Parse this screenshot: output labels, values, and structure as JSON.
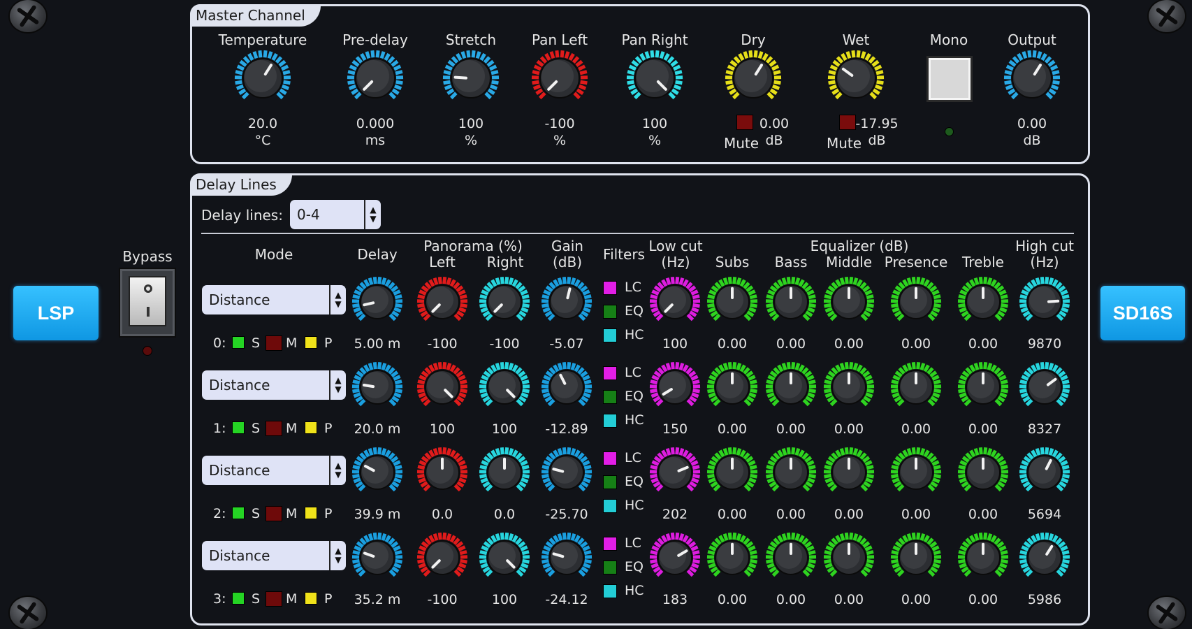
{
  "brand_left": "LSP",
  "brand_right": "SD16S",
  "bypass": {
    "label": "Bypass"
  },
  "master": {
    "title": "Master Channel",
    "knobs": [
      {
        "label": "Temperature",
        "value": "20.0",
        "unit": "°C",
        "color": "#29a9e6",
        "level": 0.62
      },
      {
        "label": "Pre-delay",
        "value": "0.000",
        "unit": "ms",
        "color": "#29a9e6",
        "level": 0.0
      },
      {
        "label": "Stretch",
        "value": "100",
        "unit": "%",
        "color": "#29a9e6",
        "level": 0.18
      },
      {
        "label": "Pan Left",
        "value": "-100",
        "unit": "%",
        "color": "#e11b1b",
        "level": 0.0
      },
      {
        "label": "Pan Right",
        "value": "100",
        "unit": "%",
        "color": "#2fdde6",
        "level": 1.0
      },
      {
        "label": "Dry",
        "value": "0.00",
        "unit": "dB",
        "color": "#e6df19",
        "level": 0.62
      },
      {
        "label": "Wet",
        "value": "-17.95",
        "unit": "dB",
        "color": "#e6df19",
        "level": 0.3
      },
      {
        "label": "Output",
        "value": "0.00",
        "unit": "dB",
        "color": "#29a9e6",
        "level": 0.62
      }
    ],
    "mute_label": "Mute",
    "mono_label": "Mono"
  },
  "delay": {
    "title": "Delay Lines",
    "selector_label": "Delay lines:",
    "selector_value": "0-4",
    "headers": {
      "mode": "Mode",
      "delay": "Delay",
      "panorama": "Panorama (%)",
      "left": "Left",
      "right": "Right",
      "gain": "Gain",
      "gain_unit": "(dB)",
      "filters": "Filters",
      "low_cut": "Low cut",
      "low_cut_unit": "(Hz)",
      "equalizer": "Equalizer (dB)",
      "subs": "Subs",
      "bass": "Bass",
      "middle": "Middle",
      "presence": "Presence",
      "treble": "Treble",
      "high_cut": "High cut",
      "high_cut_unit": "(Hz)"
    },
    "smp": {
      "s": "S",
      "m": "M",
      "p": "P"
    },
    "filter_labels": {
      "lc": "LC",
      "eq": "EQ",
      "hc": "HC"
    },
    "rows": [
      {
        "index": "0:",
        "mode": "Distance",
        "delay": "5.00 m",
        "left": "-100",
        "right": "-100",
        "gain": "-5.07",
        "lowcut": "100",
        "subs": "0.00",
        "bass": "0.00",
        "middle": "0.00",
        "presence": "0.00",
        "treble": "0.00",
        "highcut": "9870",
        "levels": {
          "delay": 0.12,
          "left": 0.0,
          "right": 0.0,
          "gain": 0.55,
          "lowcut": 0.0,
          "highcut": 0.82
        }
      },
      {
        "index": "1:",
        "mode": "Distance",
        "delay": "20.0 m",
        "left": "100",
        "right": "100",
        "gain": "-12.89",
        "lowcut": "150",
        "subs": "0.00",
        "bass": "0.00",
        "middle": "0.00",
        "presence": "0.00",
        "treble": "0.00",
        "highcut": "8327",
        "levels": {
          "delay": 0.2,
          "left": 1.0,
          "right": 1.0,
          "gain": 0.4,
          "lowcut": 0.05,
          "highcut": 0.7
        }
      },
      {
        "index": "2:",
        "mode": "Distance",
        "delay": "39.9 m",
        "left": "0.0",
        "right": "0.0",
        "gain": "-25.70",
        "lowcut": "202",
        "subs": "0.00",
        "bass": "0.00",
        "middle": "0.00",
        "presence": "0.00",
        "treble": "0.00",
        "highcut": "5694",
        "levels": {
          "delay": 0.27,
          "left": 0.5,
          "right": 0.5,
          "gain": 0.22,
          "lowcut": 0.75,
          "highcut": 0.6
        }
      },
      {
        "index": "3:",
        "mode": "Distance",
        "delay": "35.2 m",
        "left": "-100",
        "right": "100",
        "gain": "-24.12",
        "lowcut": "183",
        "subs": "0.00",
        "bass": "0.00",
        "middle": "0.00",
        "presence": "0.00",
        "treble": "0.00",
        "highcut": "5986",
        "levels": {
          "delay": 0.24,
          "left": 0.0,
          "right": 1.0,
          "gain": 0.23,
          "lowcut": 0.72,
          "highcut": 0.62
        }
      }
    ],
    "colors": {
      "delay": "#1a9fe0",
      "left": "#e11b1b",
      "right": "#27d6de",
      "gain": "#1a9fe0",
      "lowcut": "#de1ce0",
      "eq": "#2ed41f",
      "highcut": "#27d6de"
    }
  }
}
